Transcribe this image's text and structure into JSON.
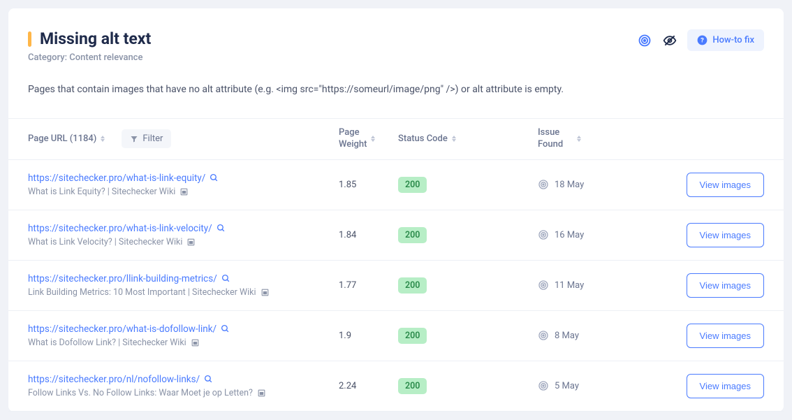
{
  "header": {
    "title": "Missing alt text",
    "category": "Category: Content relevance",
    "howto_label": "How-to fix"
  },
  "description": "Pages that contain images that have no alt attribute (e.g. <img src=\"https://someurl/image/png\" />) or alt attribute is empty.",
  "columns": {
    "url_label": "Page URL (1184)",
    "filter_label": "Filter",
    "weight_label": "Page\nWeight",
    "status_label": "Status Code",
    "issue_label": "Issue\nFound"
  },
  "rows": [
    {
      "url": "https://sitechecker.pro/what-is-link-equity/",
      "subtitle": "What is Link Equity? | Sitechecker Wiki",
      "weight": "1.85",
      "status": "200",
      "date": "18 May",
      "action": "View images"
    },
    {
      "url": "https://sitechecker.pro/what-is-link-velocity/",
      "subtitle": "What is Link Velocity? | Sitechecker Wiki",
      "weight": "1.84",
      "status": "200",
      "date": "16 May",
      "action": "View images"
    },
    {
      "url": "https://sitechecker.pro/llink-building-metrics/",
      "subtitle": "Link Building Metrics: 10 Most Important | Sitechecker Wiki",
      "weight": "1.77",
      "status": "200",
      "date": "11 May",
      "action": "View images"
    },
    {
      "url": "https://sitechecker.pro/what-is-dofollow-link/",
      "subtitle": "What is Dofollow Link? | Sitechecker Wiki",
      "weight": "1.9",
      "status": "200",
      "date": "8 May",
      "action": "View images"
    },
    {
      "url": "https://sitechecker.pro/nl/nofollow-links/",
      "subtitle": "Follow Links Vs. No Follow Links: Waar Moet je op Letten?",
      "weight": "2.24",
      "status": "200",
      "date": "5 May",
      "action": "View images"
    }
  ]
}
